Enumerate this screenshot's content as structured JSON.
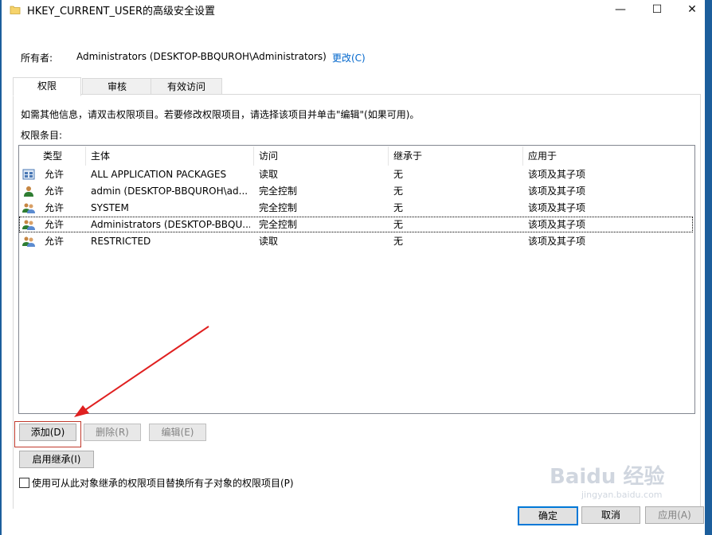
{
  "window": {
    "title": "HKEY_CURRENT_USER的高级安全设置",
    "minimize_glyph": "—",
    "maximize_glyph": "☐",
    "close_glyph": "✕"
  },
  "owner": {
    "label": "所有者:",
    "value": "Administrators (DESKTOP-BBQUROH\\Administrators)",
    "change_link": "更改(C)"
  },
  "tabs": [
    {
      "label": "权限",
      "active": true
    },
    {
      "label": "审核",
      "active": false
    },
    {
      "label": "有效访问",
      "active": false
    }
  ],
  "info_text": "如需其他信息，请双击权限项目。若要修改权限项目，请选择该项目并单击\"编辑\"(如果可用)。",
  "entries_label": "权限条目:",
  "columns": [
    "类型",
    "主体",
    "访问",
    "继承于",
    "应用于"
  ],
  "rows": [
    {
      "icon": "app-packages-icon",
      "type": "允许",
      "principal": "ALL APPLICATION PACKAGES",
      "access": "读取",
      "inherited": "无",
      "applies": "该项及其子项",
      "selected": false
    },
    {
      "icon": "user-icon",
      "type": "允许",
      "principal": "admin (DESKTOP-BBQUROH\\ad...",
      "access": "完全控制",
      "inherited": "无",
      "applies": "该项及其子项",
      "selected": false
    },
    {
      "icon": "group-icon",
      "type": "允许",
      "principal": "SYSTEM",
      "access": "完全控制",
      "inherited": "无",
      "applies": "该项及其子项",
      "selected": false
    },
    {
      "icon": "group-icon",
      "type": "允许",
      "principal": "Administrators (DESKTOP-BBQU...",
      "access": "完全控制",
      "inherited": "无",
      "applies": "该项及其子项",
      "selected": true
    },
    {
      "icon": "group-icon",
      "type": "允许",
      "principal": "RESTRICTED",
      "access": "读取",
      "inherited": "无",
      "applies": "该项及其子项",
      "selected": false
    }
  ],
  "buttons": {
    "add": "添加(D)",
    "remove": "删除(R)",
    "edit": "编辑(E)",
    "enable_inheritance": "启用继承(I)"
  },
  "replace_checkbox_label": "使用可从此对象继承的权限项目替换所有子对象的权限项目(P)",
  "footer": {
    "ok": "确定",
    "cancel": "取消",
    "apply": "应用(A)"
  },
  "watermark": {
    "brand": "Baidu 经验",
    "url": "jingyan.baidu.com"
  },
  "colors": {
    "link": "#0066cc",
    "window_border": "#1c5e9c",
    "highlight_frame": "#c0392b",
    "arrow": "#e02020"
  }
}
